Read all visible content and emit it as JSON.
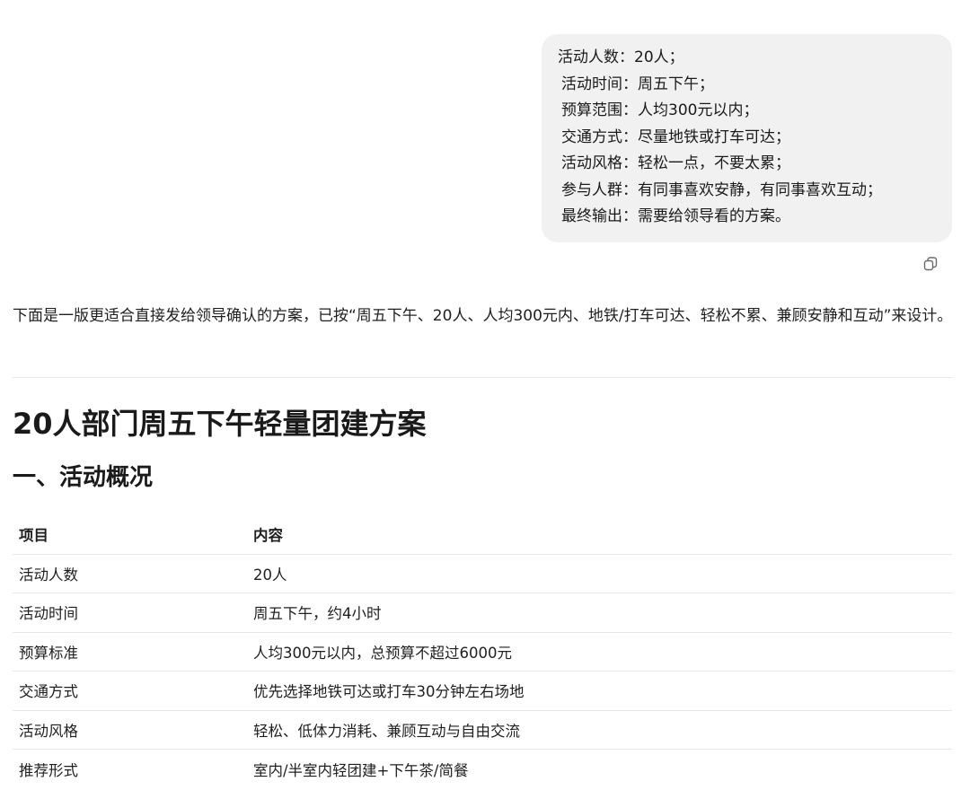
{
  "user_message": {
    "lines": [
      "活动人数：20人；",
      "活动时间：周五下午；",
      "预算范围：人均300元以内；",
      "交通方式：尽量地铁或打车可达；",
      "活动风格：轻松一点，不要太累；",
      "参与人群：有同事喜欢安静，有同事喜欢互动；",
      "最终输出：需要给领导看的方案。"
    ],
    "copy_icon": "copy-icon"
  },
  "assistant": {
    "intro": "下面是一版更适合直接发给领导确认的方案，已按“周五下午、20人、人均300元内、地铁/打车可达、轻松不累、兼顾安静和互动”来设计。",
    "doc_title": "20人部门周五下午轻量团建方案",
    "section_title": "一、活动概况",
    "table": {
      "headers": [
        "项目",
        "内容"
      ],
      "rows": [
        [
          "活动人数",
          "20人"
        ],
        [
          "活动时间",
          "周五下午，约4小时"
        ],
        [
          "预算标准",
          "人均300元以内，总预算不超过6000元"
        ],
        [
          "交通方式",
          "优先选择地铁可达或打车30分钟左右场地"
        ],
        [
          "活动风格",
          "轻松、低体力消耗、兼顾互动与自由交流"
        ],
        [
          "推荐形式",
          "室内/半室内轻团建+下午茶/简餐"
        ]
      ]
    }
  },
  "colors": {
    "bubble_bg": "#f1f1f1",
    "text": "#1f1f1f",
    "divider": "#e6e6e6"
  }
}
